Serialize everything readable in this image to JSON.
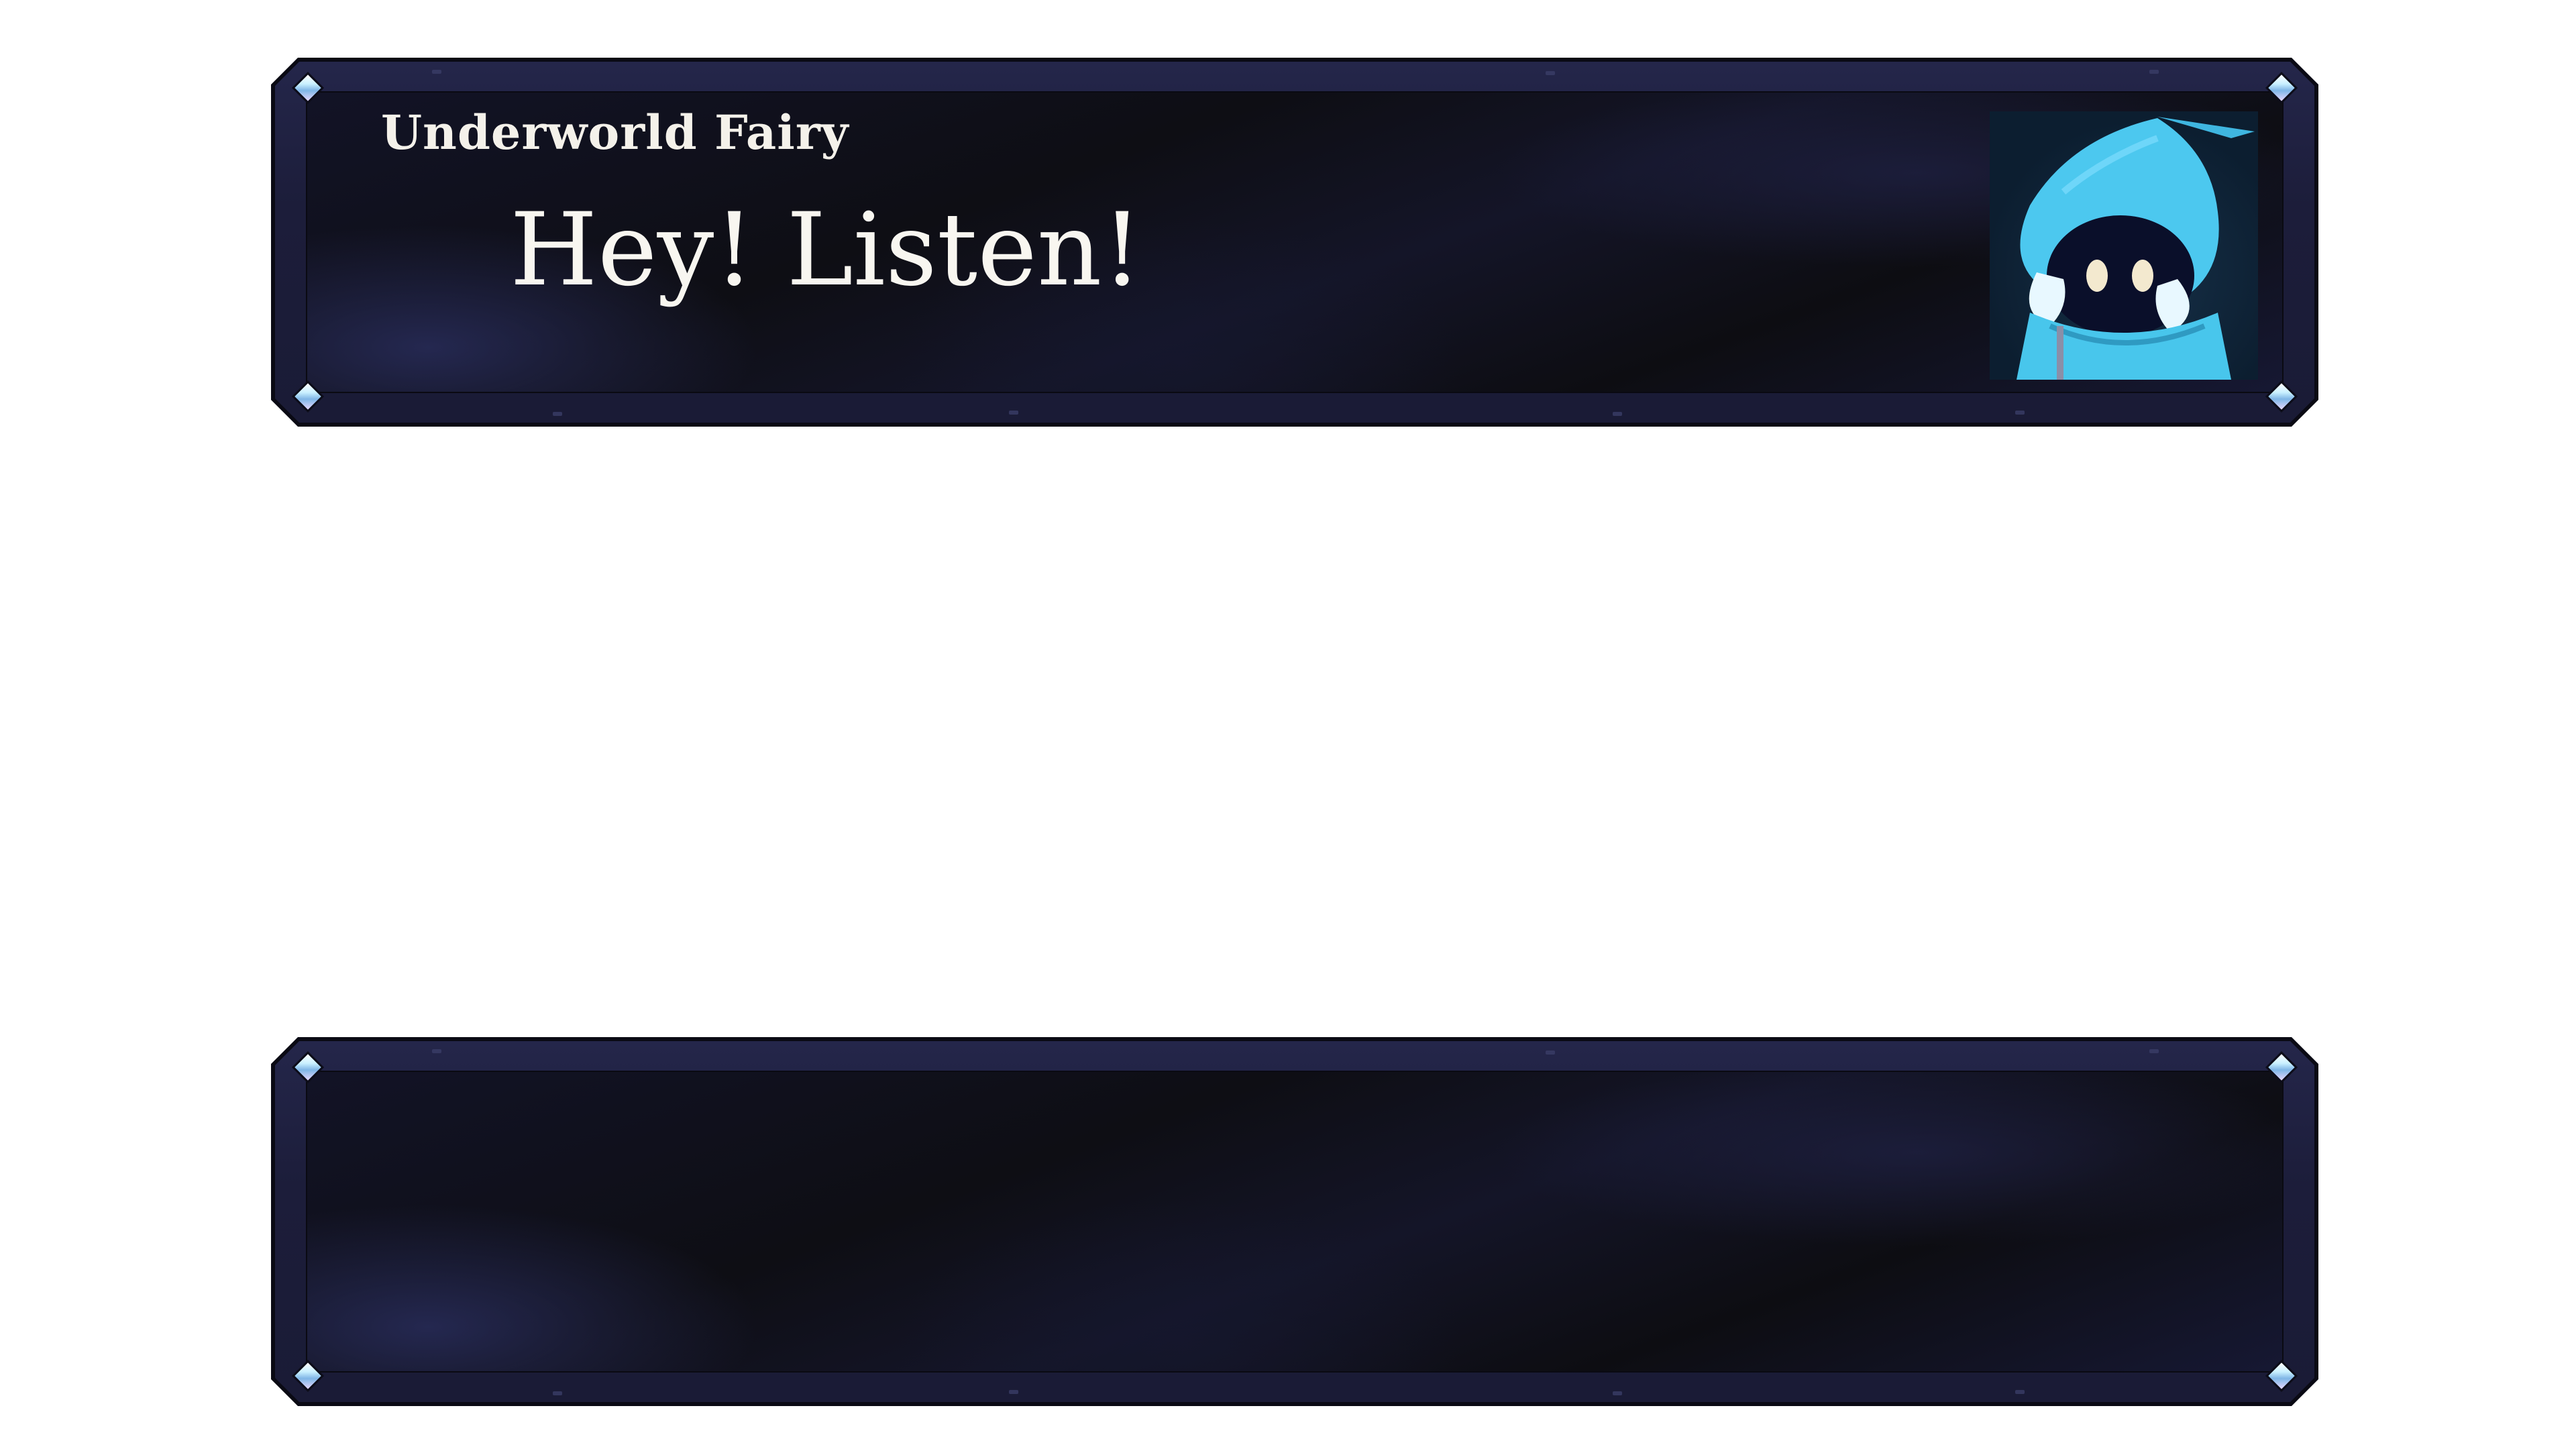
{
  "dialog": {
    "speaker_name": "Underworld Fairy",
    "text": "Hey! Listen!",
    "portrait_icon": "hooded-fairy-portrait"
  },
  "colors": {
    "frame": "#1c1d3a",
    "panel": "#0e0e14",
    "text": "#f8f6f0",
    "fairy_cloak": "#48c6ec",
    "gem": "#c9f0ff"
  }
}
